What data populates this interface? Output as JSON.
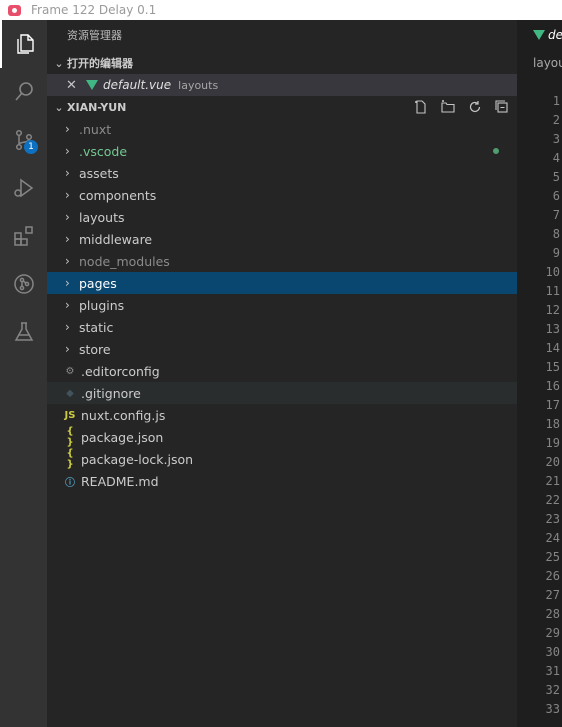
{
  "window": {
    "title": "Frame 122 Delay 0.1"
  },
  "activity": {
    "scm_badge": "1"
  },
  "sidebar": {
    "title": "资源管理器",
    "open_editors": {
      "label": "打开的编辑器",
      "items": [
        {
          "file": "default.vue",
          "folder": "layouts"
        }
      ]
    },
    "workspace": {
      "label": "XIAN-YUN"
    },
    "tree": [
      {
        "name": ".nuxt",
        "kind": "folder",
        "style": "dim"
      },
      {
        "name": ".vscode",
        "kind": "folder",
        "style": "git"
      },
      {
        "name": "assets",
        "kind": "folder",
        "style": ""
      },
      {
        "name": "components",
        "kind": "folder",
        "style": ""
      },
      {
        "name": "layouts",
        "kind": "folder",
        "style": ""
      },
      {
        "name": "middleware",
        "kind": "folder",
        "style": ""
      },
      {
        "name": "node_modules",
        "kind": "folder",
        "style": "dim"
      },
      {
        "name": "pages",
        "kind": "folder",
        "style": "sel"
      },
      {
        "name": "plugins",
        "kind": "folder",
        "style": ""
      },
      {
        "name": "static",
        "kind": "folder",
        "style": ""
      },
      {
        "name": "store",
        "kind": "folder",
        "style": ""
      },
      {
        "name": ".editorconfig",
        "kind": "gear",
        "style": ""
      },
      {
        "name": ".gitignore",
        "kind": "git",
        "style": ""
      },
      {
        "name": "nuxt.config.js",
        "kind": "js",
        "style": ""
      },
      {
        "name": "package.json",
        "kind": "json",
        "style": ""
      },
      {
        "name": "package-lock.json",
        "kind": "json",
        "style": ""
      },
      {
        "name": "README.md",
        "kind": "info",
        "style": ""
      }
    ]
  },
  "editor": {
    "tab_label": "default.vue",
    "breadcrumb": "layouts",
    "line_numbers": [
      "1",
      "2",
      "3",
      "4",
      "5",
      "6",
      "7",
      "8",
      "9",
      "10",
      "11",
      "12",
      "13",
      "14",
      "15",
      "16",
      "17",
      "18",
      "19",
      "20",
      "21",
      "22",
      "23",
      "24",
      "25",
      "26",
      "27",
      "28",
      "29",
      "30",
      "31",
      "32",
      "33"
    ]
  },
  "colors": {
    "selection": "#094771",
    "git_modified": "#73c991",
    "vue": "#41b883",
    "json": "#cbcb41",
    "badge": "#0e70c0"
  }
}
